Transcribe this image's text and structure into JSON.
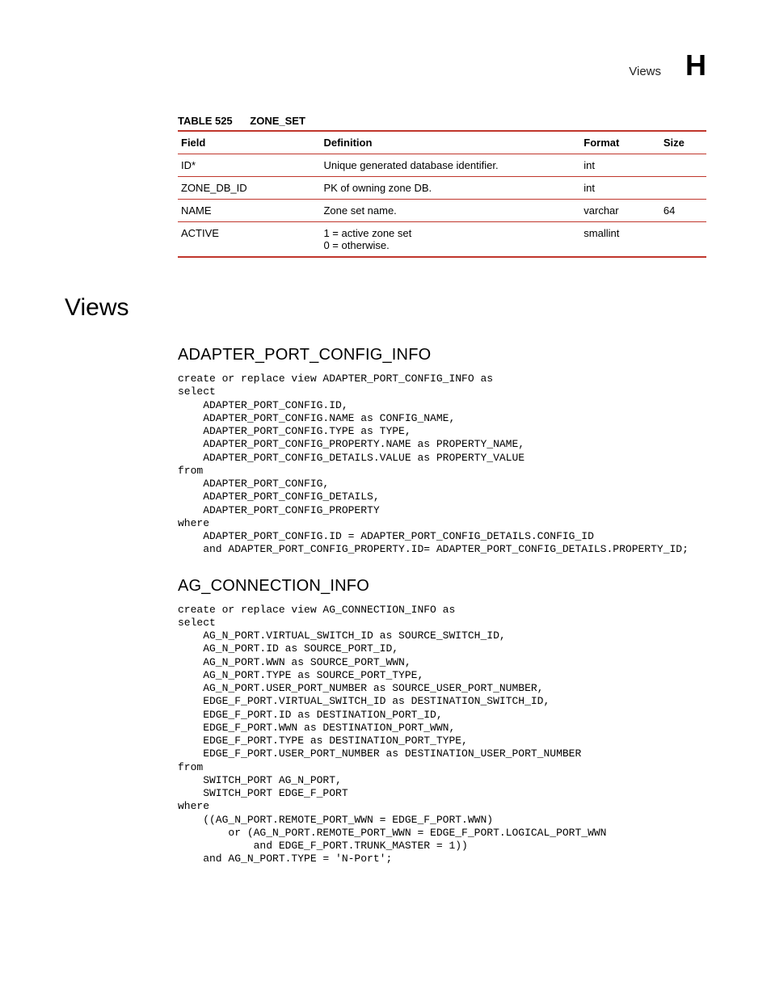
{
  "header": {
    "label": "Views",
    "letter": "H"
  },
  "table": {
    "caption_prefix": "TABLE 525",
    "caption_name": "ZONE_SET",
    "columns": {
      "field": "Field",
      "definition": "Definition",
      "format": "Format",
      "size": "Size"
    },
    "rows": [
      {
        "field": "ID*",
        "definition": "Unique generated database identifier.",
        "format": "int",
        "size": ""
      },
      {
        "field": "ZONE_DB_ID",
        "definition": "PK of owning zone DB.",
        "format": "int",
        "size": ""
      },
      {
        "field": "NAME",
        "definition": "Zone set name.",
        "format": "varchar",
        "size": "64"
      },
      {
        "field": "ACTIVE",
        "definition": "1 = active zone set\n0 = otherwise.",
        "format": "smallint",
        "size": ""
      }
    ]
  },
  "section_title": "Views",
  "views": [
    {
      "name": "ADAPTER_PORT_CONFIG_INFO",
      "sql": "create or replace view ADAPTER_PORT_CONFIG_INFO as\nselect\n    ADAPTER_PORT_CONFIG.ID,\n    ADAPTER_PORT_CONFIG.NAME as CONFIG_NAME,\n    ADAPTER_PORT_CONFIG.TYPE as TYPE,\n    ADAPTER_PORT_CONFIG_PROPERTY.NAME as PROPERTY_NAME,\n    ADAPTER_PORT_CONFIG_DETAILS.VALUE as PROPERTY_VALUE\nfrom\n    ADAPTER_PORT_CONFIG,\n    ADAPTER_PORT_CONFIG_DETAILS,\n    ADAPTER_PORT_CONFIG_PROPERTY\nwhere\n    ADAPTER_PORT_CONFIG.ID = ADAPTER_PORT_CONFIG_DETAILS.CONFIG_ID\n    and ADAPTER_PORT_CONFIG_PROPERTY.ID= ADAPTER_PORT_CONFIG_DETAILS.PROPERTY_ID;"
    },
    {
      "name": "AG_CONNECTION_INFO",
      "sql": "create or replace view AG_CONNECTION_INFO as\nselect\n    AG_N_PORT.VIRTUAL_SWITCH_ID as SOURCE_SWITCH_ID,\n    AG_N_PORT.ID as SOURCE_PORT_ID,\n    AG_N_PORT.WWN as SOURCE_PORT_WWN,\n    AG_N_PORT.TYPE as SOURCE_PORT_TYPE,\n    AG_N_PORT.USER_PORT_NUMBER as SOURCE_USER_PORT_NUMBER,\n    EDGE_F_PORT.VIRTUAL_SWITCH_ID as DESTINATION_SWITCH_ID,\n    EDGE_F_PORT.ID as DESTINATION_PORT_ID,\n    EDGE_F_PORT.WWN as DESTINATION_PORT_WWN,\n    EDGE_F_PORT.TYPE as DESTINATION_PORT_TYPE,\n    EDGE_F_PORT.USER_PORT_NUMBER as DESTINATION_USER_PORT_NUMBER\nfrom\n    SWITCH_PORT AG_N_PORT,\n    SWITCH_PORT EDGE_F_PORT\nwhere\n    ((AG_N_PORT.REMOTE_PORT_WWN = EDGE_F_PORT.WWN)\n        or (AG_N_PORT.REMOTE_PORT_WWN = EDGE_F_PORT.LOGICAL_PORT_WWN\n            and EDGE_F_PORT.TRUNK_MASTER = 1))\n    and AG_N_PORT.TYPE = 'N-Port';"
    }
  ]
}
